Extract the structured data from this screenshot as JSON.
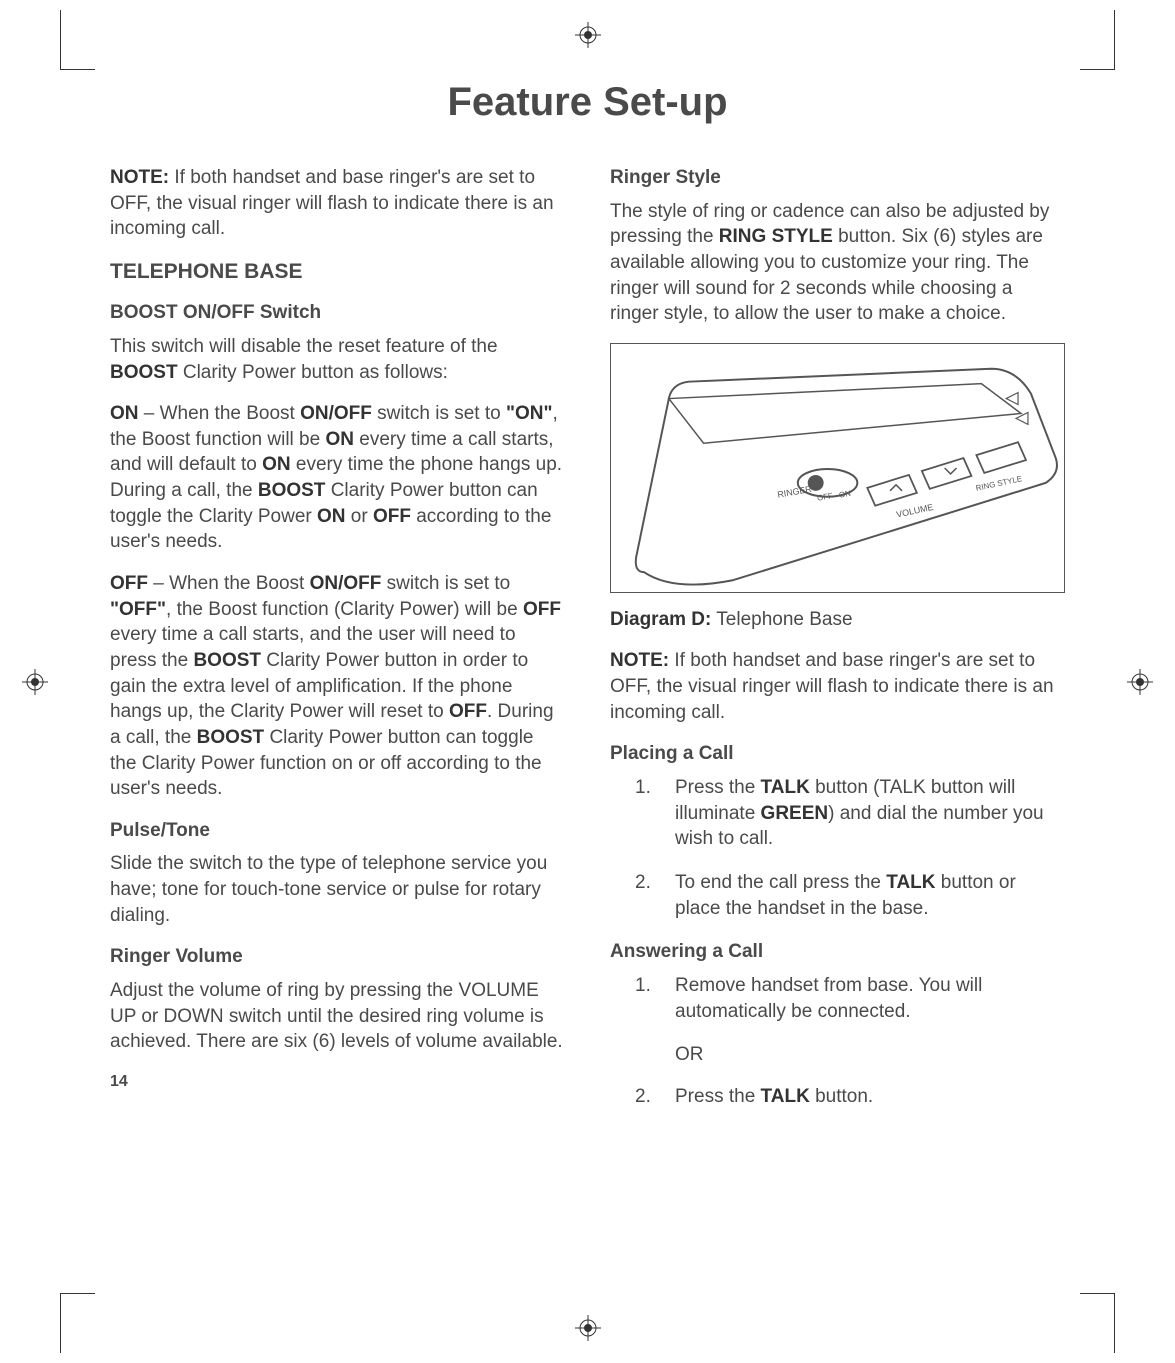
{
  "title": "Feature Set-up",
  "col1": {
    "note1_a": "NOTE:",
    "note1_b": " If both handset and base ringer's are set to OFF, the visual ringer will flash to indicate there is an incoming call.",
    "h2_base": "TELEPHONE BASE",
    "h3_boost": "BOOST ON/OFF Switch",
    "boost_p1_a": "This switch will disable the reset feature of the ",
    "boost_p1_b": "BOOST",
    "boost_p1_c": " Clarity Power button as follows:",
    "on_a": "ON",
    "on_b": " – When the Boost ",
    "on_c": "ON/OFF",
    "on_d": " switch is set to ",
    "on_e": "\"ON\"",
    "on_f": ", the Boost function will be ",
    "on_g": "ON",
    "on_h": " every time a call starts, and will default to ",
    "on_i": "ON",
    "on_j": " every time the phone hangs up. During a call, the ",
    "on_k": "BOOST",
    "on_l": " Clarity Power button can toggle the Clarity Power ",
    "on_m": "ON",
    "on_n": " or ",
    "on_o": "OFF",
    "on_p": " according to the user's needs.",
    "off_a": "OFF",
    "off_b": " – When the Boost ",
    "off_c": "ON/OFF",
    "off_d": " switch is set to ",
    "off_e": "\"OFF\"",
    "off_f": ", the Boost function (Clarity Power) will be ",
    "off_g": "OFF",
    "off_h": " every time a call starts, and the user will need to press the ",
    "off_i": "BOOST",
    "off_j": " Clarity Power button in order to gain the extra level of amplification. If the phone hangs up, the Clarity Power will reset to ",
    "off_k": "OFF",
    "off_l": ". During a call, the ",
    "off_m": "BOOST",
    "off_n": " Clarity Power button can toggle the Clarity Power function on or off according to the user's needs.",
    "h3_pulse": "Pulse/Tone",
    "pulse_p": "Slide the switch to the type of telephone service you have; tone for touch-tone service or pulse for rotary dialing.",
    "h3_rvol": "Ringer Volume",
    "rvol_p": "Adjust the volume of ring by pressing the VOLUME UP or DOWN switch until the desired ring volume is achieved. There are six (6) levels of volume available.",
    "pagenum": "14"
  },
  "col2": {
    "h3_rstyle": "Ringer Style",
    "rstyle_p_a": "The style of ring or cadence can also be adjusted by pressing the ",
    "rstyle_p_b": "RING STYLE",
    "rstyle_p_c": " button. Six (6) styles are available allowing you to customize your ring.  The ringer will sound for 2 seconds while choosing a ringer style, to allow the user to make a choice.",
    "diag_label_a": "Diagram D:",
    "diag_label_b": " Telephone Base",
    "note2_a": "NOTE:",
    "note2_b": " If both handset and base ringer's are set to OFF, the visual ringer will flash to indicate there is an incoming call.",
    "h3_place": "Placing a Call",
    "place1_num": "1.",
    "place1_a": "Press the ",
    "place1_b": "TALK",
    "place1_c": " button (TALK button will illuminate ",
    "place1_d": "GREEN",
    "place1_e": ") and dial the number you wish to call.",
    "place2_num": "2.",
    "place2_a": "To end the call press the ",
    "place2_b": "TALK",
    "place2_c": " button or place the handset in the base.",
    "h3_ans": "Answering a Call",
    "ans1_num": "1.",
    "ans1": "Remove handset from base. You will automatically be connected.",
    "or": "OR",
    "ans2_num": "2.",
    "ans2_a": "Press the ",
    "ans2_b": "TALK",
    "ans2_c": " button."
  },
  "diagram": {
    "ringer": "RINGER",
    "off": "OFF",
    "on": "ON",
    "volume": "VOLUME",
    "ringstyle": "RING STYLE"
  }
}
